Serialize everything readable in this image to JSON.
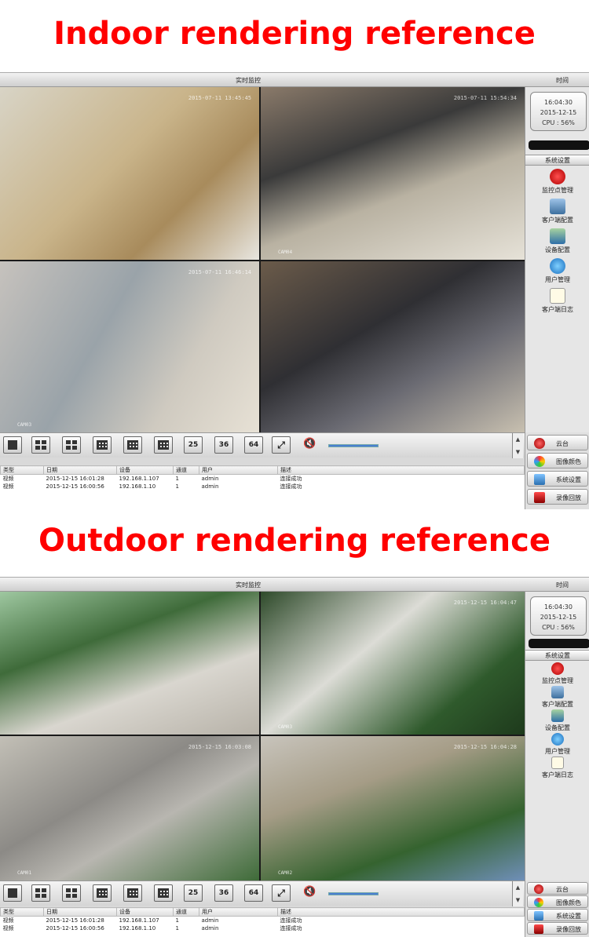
{
  "headings": {
    "indoor": "Indoor rendering reference",
    "outdoor": "Outdoor rendering reference"
  },
  "window": {
    "title": "实时监控",
    "time_header": "时间"
  },
  "clock": {
    "time": "16:04:30",
    "date": "2015-12-15",
    "cpu": "CPU : 56%"
  },
  "sidebar": {
    "header": "系统设置",
    "items": [
      {
        "label": "监控点管理",
        "icon": "monitor-point-icon"
      },
      {
        "label": "客户端配置",
        "icon": "client-config-icon"
      },
      {
        "label": "设备配置",
        "icon": "device-config-icon"
      },
      {
        "label": "用户管理",
        "icon": "user-management-icon"
      },
      {
        "label": "客户端日志",
        "icon": "client-log-icon"
      }
    ]
  },
  "indoor_cams": [
    {
      "timestamp": "2015-07-11 13:45:45",
      "label": ""
    },
    {
      "timestamp": "2015-07-11 15:54:34",
      "label": "CAM04"
    },
    {
      "timestamp": "2015-07-11 16:46:14",
      "label": "CAM03"
    },
    {
      "timestamp": "",
      "label": ""
    }
  ],
  "outdoor_cams": [
    {
      "timestamp": "",
      "label": ""
    },
    {
      "timestamp": "2015-12-15 16:04:47",
      "label": "CAM03"
    },
    {
      "timestamp": "2015-12-15 16:03:08",
      "label": "CAM01"
    },
    {
      "timestamp": "2015-12-15 16:04:28",
      "label": "CAM02"
    }
  ],
  "toolbar": {
    "layouts": [
      "1",
      "4",
      "6",
      "9",
      "8",
      "16",
      "25",
      "36",
      "64"
    ],
    "fullscreen_icon": "fullscreen-icon",
    "mute_icon": "speaker-mute-icon"
  },
  "log": {
    "columns": [
      "类型",
      "日期",
      "设备",
      "通道",
      "用户",
      "描述"
    ],
    "rows": [
      [
        "视频",
        "2015-12-15 16:01:28",
        "192.168.1.107",
        "1",
        "admin",
        "连接成功"
      ],
      [
        "视频",
        "2015-12-15 16:00:56",
        "192.168.1.10",
        "1",
        "admin",
        "连接成功"
      ]
    ]
  },
  "right_buttons": [
    {
      "label": "云台",
      "icon": "ptz-icon"
    },
    {
      "label": "图像颜色",
      "icon": "image-color-icon"
    },
    {
      "label": "系统设置",
      "icon": "system-settings-icon"
    },
    {
      "label": "录像回放",
      "icon": "playback-icon"
    }
  ]
}
